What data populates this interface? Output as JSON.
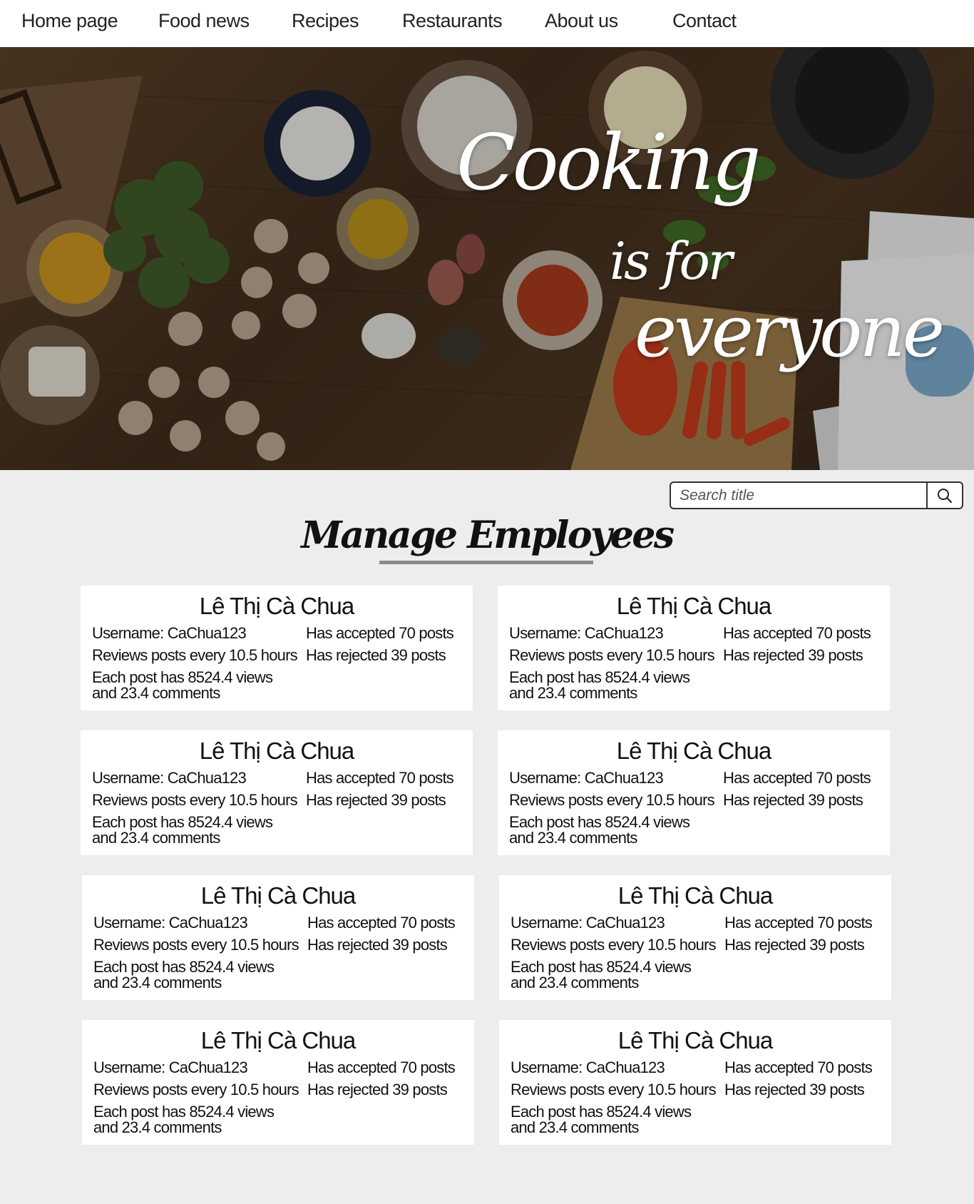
{
  "nav": {
    "items": [
      {
        "label": "Home page"
      },
      {
        "label": "Food news"
      },
      {
        "label": "Recipes"
      },
      {
        "label": "Restaurants"
      },
      {
        "label": "About us"
      },
      {
        "label": "Contact"
      }
    ]
  },
  "hero": {
    "line1": "Cooking",
    "line2": "is for",
    "line3": "everyone"
  },
  "search": {
    "placeholder": "Search title",
    "icon": "search-icon"
  },
  "page_title": "Manage Employees",
  "employees": [
    {
      "name": "Lê Thị Cà Chua",
      "username": "Username: CaChua123",
      "review": "Reviews posts every 10.5 hours",
      "views": "Each post has 8524.4 views",
      "comments": "and 23.4 comments",
      "accepted": "Has accepted 70 posts",
      "rejected": "Has rejected 39 posts"
    },
    {
      "name": "Lê Thị Cà Chua",
      "username": "Username: CaChua123",
      "review": "Reviews posts every 10.5 hours",
      "views": "Each post has 8524.4 views",
      "comments": "and 23.4 comments",
      "accepted": "Has accepted 70 posts",
      "rejected": "Has rejected 39 posts"
    },
    {
      "name": "Lê Thị Cà Chua",
      "username": "Username: CaChua123",
      "review": "Reviews posts every 10.5 hours",
      "views": "Each post has 8524.4 views",
      "comments": "and 23.4 comments",
      "accepted": "Has accepted 70 posts",
      "rejected": "Has rejected 39 posts"
    },
    {
      "name": "Lê Thị Cà Chua",
      "username": "Username: CaChua123",
      "review": "Reviews posts every 10.5 hours",
      "views": "Each post has 8524.4 views",
      "comments": "and 23.4 comments",
      "accepted": "Has accepted 70 posts",
      "rejected": "Has rejected 39 posts"
    },
    {
      "name": "Lê Thị Cà Chua",
      "username": "Username: CaChua123",
      "review": "Reviews posts every 10.5 hours",
      "views": "Each post has 8524.4 views",
      "comments": "and 23.4 comments",
      "accepted": "Has accepted 70 posts",
      "rejected": "Has rejected 39 posts"
    },
    {
      "name": "Lê Thị Cà Chua",
      "username": "Username: CaChua123",
      "review": "Reviews posts every 10.5 hours",
      "views": "Each post has 8524.4 views",
      "comments": "and 23.4 comments",
      "accepted": "Has accepted 70 posts",
      "rejected": "Has rejected 39 posts"
    },
    {
      "name": "Lê Thị Cà Chua",
      "username": "Username: CaChua123",
      "review": "Reviews posts every 10.5 hours",
      "views": "Each post has 8524.4 views",
      "comments": "and 23.4 comments",
      "accepted": "Has accepted 70 posts",
      "rejected": "Has rejected 39 posts"
    },
    {
      "name": "Lê Thị Cà Chua",
      "username": "Username: CaChua123",
      "review": "Reviews posts every 10.5 hours",
      "views": "Each post has 8524.4 views",
      "comments": "and 23.4 comments",
      "accepted": "Has accepted 70 posts",
      "rejected": "Has rejected 39 posts"
    }
  ]
}
